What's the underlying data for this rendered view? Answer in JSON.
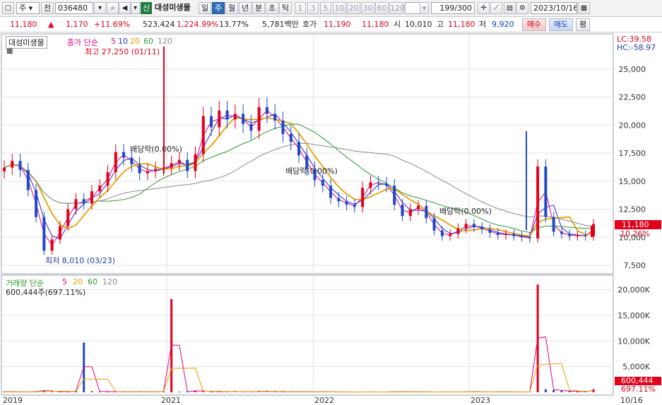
{
  "toolbar": {
    "market": "주",
    "market_arrow": "▾",
    "mode": "전",
    "code": "036480",
    "name_badge": "신",
    "stock_name": "대성미생물",
    "periods": [
      "일",
      "주",
      "월",
      "년",
      "분",
      "초",
      "틱"
    ],
    "active_period": "주",
    "numbers": [
      "1",
      "3",
      "5",
      "10",
      "20",
      "30",
      "60",
      "120"
    ],
    "count": "199/300",
    "date": "2023/10/16"
  },
  "quote": {
    "price": "11,180",
    "change": "1,170",
    "change_pct": "+11.69%",
    "volume": "523,424",
    "volume_pct": "1,224.99%",
    "turnover": "13.77%",
    "amount": "5,781백만",
    "hoga_label": "호가",
    "ask": "11,190",
    "bid": "11,180",
    "open_label": "시",
    "open": "10,010",
    "high_label": "고",
    "high": "11,180",
    "low_label": "저",
    "low": "9,920",
    "buy": "매수",
    "sell": "매도",
    "avg": "평"
  },
  "price_panel": {
    "title": "대성미생물",
    "ma_label": "종가 단순",
    "ma_periods": [
      "5",
      "10",
      "20",
      "60",
      "120"
    ],
    "ma_colors": [
      "#e3007f",
      "#2b2bd6",
      "#e8a000",
      "#2c9a2c",
      "#8a8a8a"
    ],
    "max_label": "최고 27,250 (01/11)",
    "min_label": "최저 8,010 (03/23)",
    "dividend_labels": [
      "배당락(0.00%)",
      "배당락(0.00%)",
      "배당락(0.00%)"
    ],
    "lc": "LC:39.58",
    "hc": "HC:-58.97",
    "current_price_tag": "11,180",
    "current_pct_tag": "10.26%",
    "y_ticks": [
      "25,000",
      "22,500",
      "20,000",
      "17,500",
      "15,000",
      "12,500",
      "10,000",
      "7,500"
    ]
  },
  "volume_panel": {
    "title": "거래량 단순",
    "ma_periods": [
      "5",
      "20",
      "60",
      "120"
    ],
    "ma_colors": [
      "#e3007f",
      "#e8a000",
      "#2c9a2c",
      "#8a8a8a"
    ],
    "value_label": "600,444주(697.11%)",
    "y_ticks": [
      "20,000K",
      "15,000K",
      "10,000K",
      "5,000K"
    ],
    "current_tag": "600,444",
    "pct_tag": "697.11%"
  },
  "x_axis": [
    "2019",
    "2021",
    "2022",
    "2023",
    "10/16"
  ],
  "colors": {
    "up": "#e3001b",
    "down": "#1f49c7",
    "grid": "#d9d9d9",
    "tag": "#e3001b"
  },
  "chart_data": {
    "type": "candlestick",
    "title": "대성미생물",
    "ylim": [
      7000,
      27500
    ],
    "series_close": [
      16200,
      16800,
      16000,
      14200,
      11800,
      8800,
      9800,
      11000,
      12500,
      13400,
      13000,
      14100,
      14600,
      15800,
      17600,
      17100,
      16500,
      15700,
      15900,
      16100,
      16200,
      16600,
      16900,
      15900,
      17400,
      20800,
      19800,
      21300,
      20500,
      21000,
      20100,
      19500,
      21600,
      21000,
      20400,
      19200,
      18500,
      17300,
      16100,
      15100,
      14600,
      13500,
      13200,
      12900,
      12700,
      14400,
      14900,
      14800,
      14600,
      12900,
      11900,
      12500,
      12800,
      11700,
      10600,
      10100,
      10300,
      10800,
      11200,
      10900,
      10700,
      10400,
      10200,
      10300,
      10100,
      10000,
      9900,
      16300,
      11800,
      10500,
      10300,
      10100,
      10200,
      10100,
      11180
    ],
    "series_volume": [
      120,
      90,
      60,
      80,
      200,
      400,
      130,
      110,
      150,
      300,
      9700,
      210,
      120,
      160,
      90,
      110,
      100,
      140,
      90,
      80,
      220,
      18200,
      120,
      160,
      340,
      200,
      110,
      130,
      150,
      170,
      90,
      120,
      230,
      170,
      140,
      110,
      100,
      120,
      90,
      80,
      110,
      70,
      60,
      70,
      50,
      90,
      80,
      70,
      60,
      120,
      100,
      80,
      90,
      70,
      60,
      90,
      80,
      70,
      100,
      90,
      70,
      60,
      110,
      80,
      70,
      60,
      80,
      21000,
      600,
      450,
      300,
      200,
      150,
      120,
      600
    ]
  }
}
